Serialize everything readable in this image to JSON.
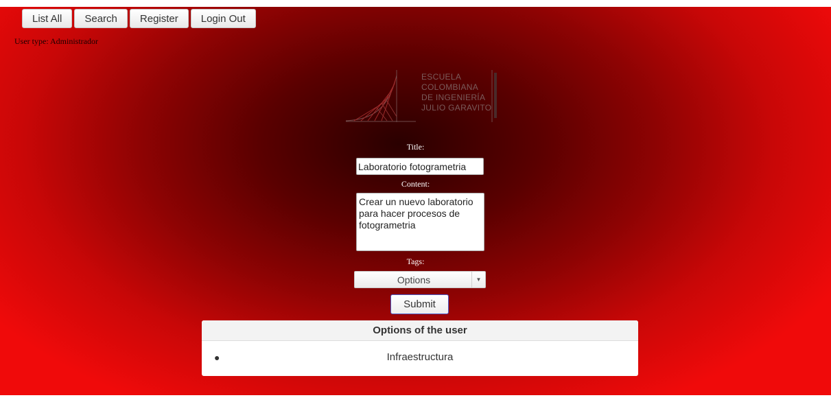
{
  "nav": {
    "list_all": "List All",
    "search": "Search",
    "register": "Register",
    "login_out": "Login Out"
  },
  "user_type": "User type: Administrador",
  "logo": {
    "lines": [
      "ESCUELA",
      "COLOMBIANA",
      "DE INGENIERÍA",
      "JULIO GARAVITO"
    ]
  },
  "form": {
    "title_label": "Title:",
    "title_value": "Laboratorio fotogrametria",
    "content_label": "Content:",
    "content_value": "Crear un nuevo laboratorio para hacer procesos de fotogrametria",
    "tags_label": "Tags:",
    "tags_select": "Options",
    "submit_label": "Submit"
  },
  "options_panel": {
    "header": "Options of the user",
    "items": [
      "Infraestructura"
    ]
  },
  "colors": {
    "background_center": "#2a0000",
    "background_edge": "#f00a0a",
    "submit_border": "#4a58c8"
  }
}
